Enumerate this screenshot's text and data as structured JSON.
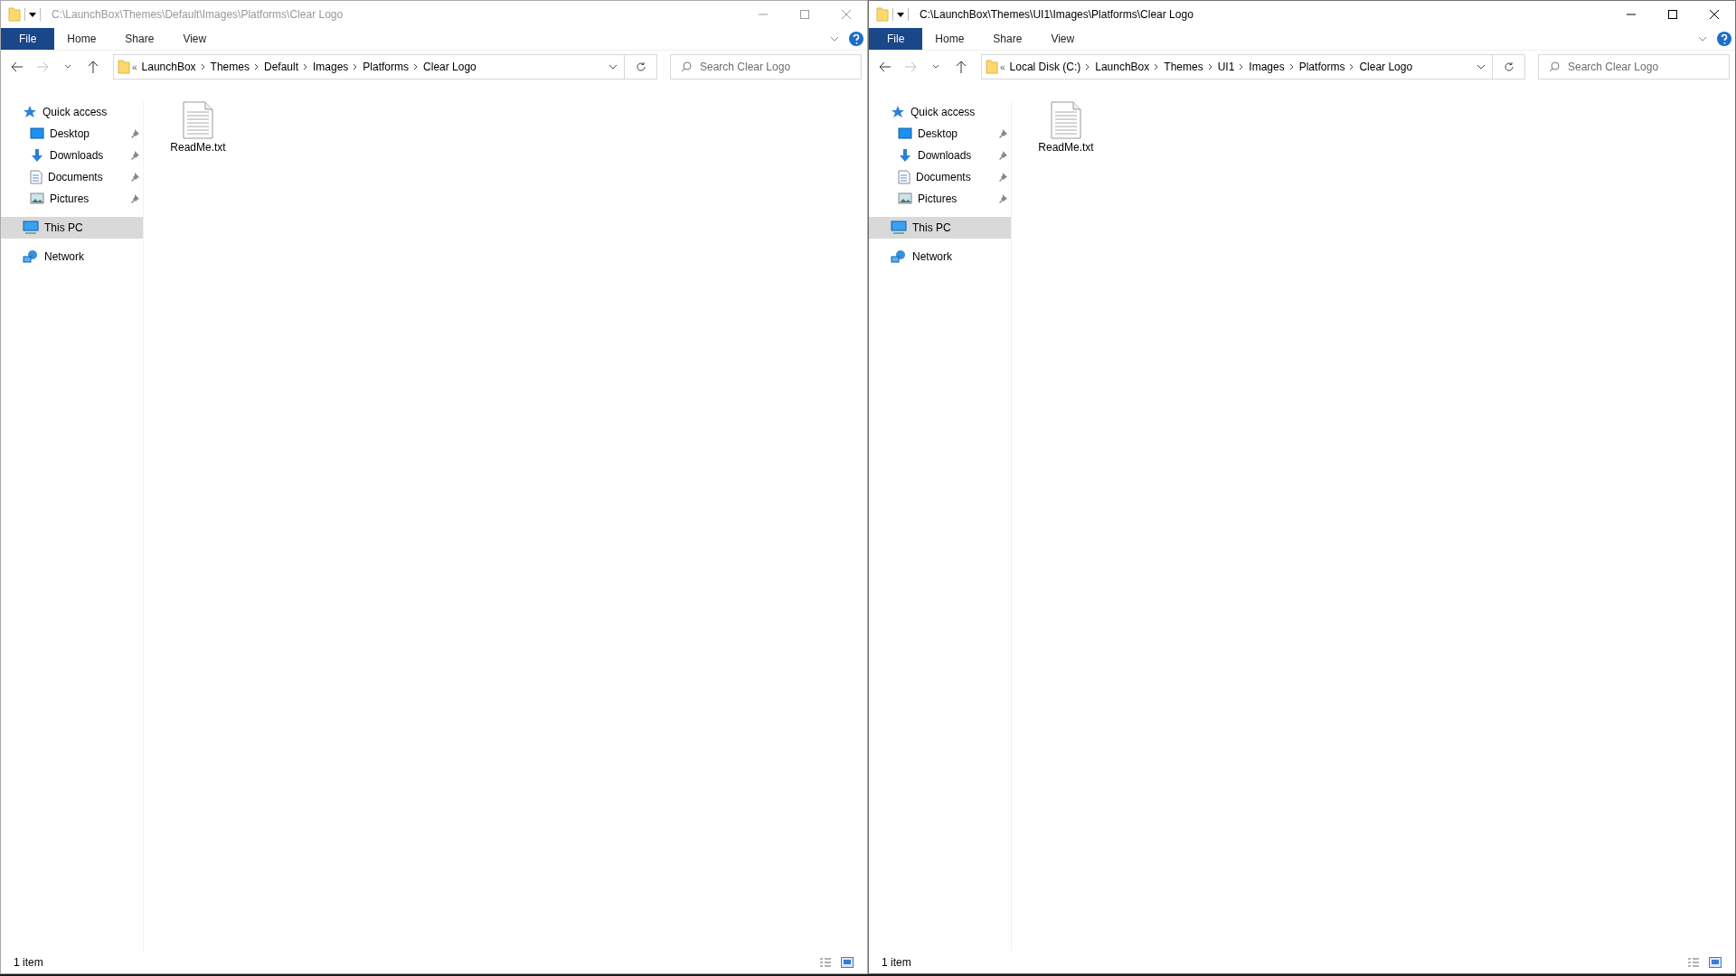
{
  "windows": [
    {
      "title": "C:\\LaunchBox\\Themes\\Default\\Images\\Platforms\\Clear Logo",
      "active": false,
      "ribbon_tabs": [
        {
          "label": "File",
          "kind": "file"
        },
        {
          "label": "Home",
          "kind": "tab"
        },
        {
          "label": "Share",
          "kind": "tab"
        },
        {
          "label": "View",
          "kind": "tab"
        }
      ],
      "overflow": "«",
      "breadcrumbs": [
        "LaunchBox",
        "Themes",
        "Default",
        "Images",
        "Platforms",
        "Clear Logo"
      ],
      "search": {
        "placeholder": "Search Clear Logo"
      },
      "navigation": [
        {
          "label": "Quick access",
          "selected": false,
          "children": [
            {
              "label": "Desktop",
              "selected": false,
              "pinned": true
            },
            {
              "label": "Downloads",
              "selected": false,
              "pinned": true
            },
            {
              "label": "Documents",
              "selected": false,
              "pinned": true
            },
            {
              "label": "Pictures",
              "selected": false,
              "pinned": true
            }
          ]
        },
        {
          "label": "This PC",
          "selected": true
        },
        {
          "label": "Network",
          "selected": false
        }
      ],
      "files": [
        {
          "name": "ReadMe.txt"
        }
      ],
      "status_bar": "1 item"
    },
    {
      "title": "C:\\LaunchBox\\Themes\\UI1\\Images\\Platforms\\Clear Logo",
      "active": true,
      "ribbon_tabs": [
        {
          "label": "File",
          "kind": "file"
        },
        {
          "label": "Home",
          "kind": "tab"
        },
        {
          "label": "Share",
          "kind": "tab"
        },
        {
          "label": "View",
          "kind": "tab"
        }
      ],
      "overflow": "«",
      "breadcrumbs": [
        "Local Disk (C:)",
        "LaunchBox",
        "Themes",
        "UI1",
        "Images",
        "Platforms",
        "Clear Logo"
      ],
      "search": {
        "placeholder": "Search Clear Logo"
      },
      "navigation": [
        {
          "label": "Quick access",
          "selected": false,
          "children": [
            {
              "label": "Desktop",
              "selected": false,
              "pinned": true
            },
            {
              "label": "Downloads",
              "selected": false,
              "pinned": true
            },
            {
              "label": "Documents",
              "selected": false,
              "pinned": true
            },
            {
              "label": "Pictures",
              "selected": false,
              "pinned": true
            }
          ]
        },
        {
          "label": "This PC",
          "selected": true
        },
        {
          "label": "Network",
          "selected": false
        }
      ],
      "files": [
        {
          "name": "ReadMe.txt"
        }
      ],
      "status_bar": "1 item"
    }
  ]
}
